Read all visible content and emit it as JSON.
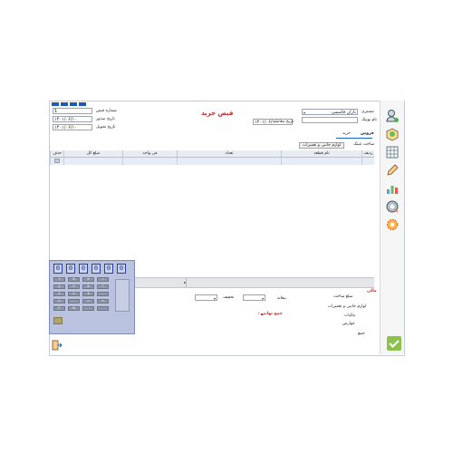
{
  "window": {
    "title": "قبض خرید",
    "title_color": "#c62828",
    "accent": "#1565c0"
  },
  "top_buttons": [
    "",
    "",
    "",
    ""
  ],
  "header": {
    "receipt_number_label": "شماره قبض",
    "receipt_number_value": "1",
    "issue_date_label": "تاریخ صدور",
    "issue_date_value": "۱۴۰۱/۰۶/۱۰",
    "delivery_date_label": "تاریخ تحویل",
    "delivery_date_value": "۱۴۰۱/۰۶/۱۰",
    "customer_label": "مشتری",
    "customer_value": "بازان قاسمی",
    "notebook_label": "نام یونیک",
    "notebook_value": "",
    "transaction_date_label": "تاریخ معامله",
    "transaction_date_value": "۱۴۰۱/۰۶/۱۰"
  },
  "tabs": {
    "sale": "فروش",
    "purchase": "خرید",
    "sub_services": "ساخت عینک",
    "sub_accessories": "لوازم جانبی و تعمیرات"
  },
  "grid": {
    "columns": [
      "ردیف",
      "نام قطعه",
      "تعداد",
      "فی واحد",
      "مبلغ کل",
      "حذف"
    ]
  },
  "totals": {
    "deposit_label": "بیعانه",
    "discount_label": "تخفیف",
    "final_total_label": "جمع نهایی :",
    "summary_title": "مالی",
    "summary_items": [
      "مبلغ ساخت",
      "لوازم جانبی و تعمیرات",
      "مالیات",
      "عوارض",
      "جمع"
    ]
  },
  "calculator": {
    "display_digits": [
      "0",
      "0",
      "0",
      "0",
      "0",
      "0"
    ],
    "keys": [
      "7",
      "8",
      "9",
      "/",
      "4",
      "5",
      "6",
      "*",
      "1",
      "2",
      "3",
      "-",
      "0",
      ".",
      "=",
      "+",
      "C",
      "%",
      "",
      ""
    ]
  },
  "sidebar_icons": [
    "add-user-icon",
    "box-icon",
    "grid-icon",
    "pencil-icon",
    "chart-icon",
    "settings-gear-icon",
    "cog-icon"
  ],
  "footer": {
    "exit_icon": "exit-door-icon",
    "confirm_icon": "checkmark-icon",
    "confirm_color": "#8bc34a"
  }
}
